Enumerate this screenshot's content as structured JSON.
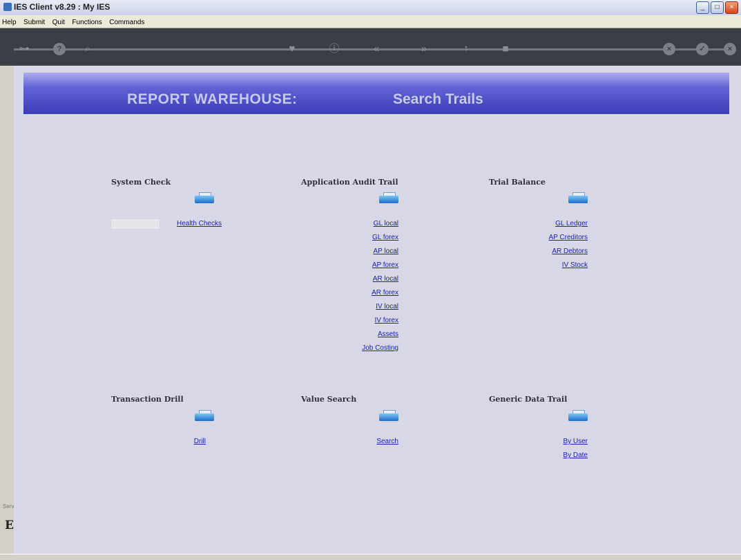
{
  "window": {
    "title": "IES Client v8.29 : My IES"
  },
  "menu": [
    "Help",
    "Submit",
    "Quit",
    "Functions",
    "Commands"
  ],
  "toolbar": {
    "icons": [
      "key-icon",
      "help-icon",
      "search-icon",
      "heart-icon",
      "info-icon",
      "back-icon",
      "forward-icon",
      "up-icon",
      "square-icon",
      "cancel-icon",
      "ok-icon",
      "close-icon"
    ]
  },
  "banner": {
    "left": "REPORT WAREHOUSE:",
    "right": "Search Trails"
  },
  "sections": {
    "system_check": {
      "title": "System Check",
      "links": [
        "Health Checks"
      ]
    },
    "audit_trail": {
      "title": "Application Audit Trail",
      "links": [
        "GL local",
        "GL forex",
        "AP local",
        "AP forex",
        "AR local",
        "AR forex",
        "IV local",
        "IV forex",
        "Assets",
        "Job Costing"
      ]
    },
    "trial_balance": {
      "title": "Trial Balance",
      "links": [
        "GL Ledger",
        "AP Creditors",
        "AR Debtors",
        "IV Stock"
      ]
    },
    "transaction_drill": {
      "title": "Transaction Drill",
      "links": [
        "Drill"
      ]
    },
    "value_search": {
      "title": "Value Search",
      "links": [
        "Search"
      ]
    },
    "generic_data_trail": {
      "title": "Generic Data Trail",
      "links": [
        "By User",
        "By Date"
      ]
    }
  },
  "gutter": {
    "glyph": "E",
    "small": "Serv"
  },
  "colors": {
    "banner_top": "#adacf0",
    "banner_bottom": "#3c3db8",
    "link": "#1f1fb5",
    "client_bg": "#d7d7e6"
  }
}
